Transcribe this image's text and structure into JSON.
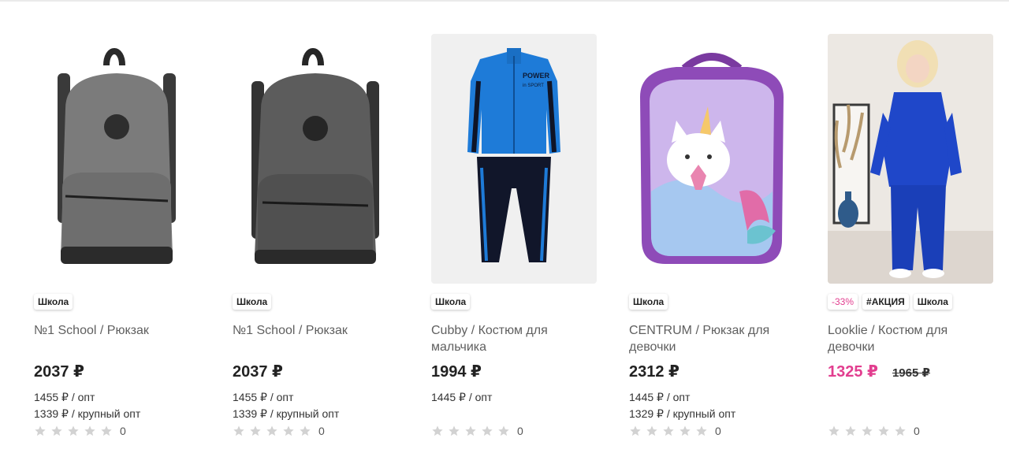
{
  "products": [
    {
      "image_icon": "backpack-grey-icon",
      "badges": [
        {
          "text": "Школа",
          "kind": "tag"
        }
      ],
      "title": "№1 School / Рюкзак",
      "price": "2037 ₽",
      "old_price": "",
      "opt": [
        "1455 ₽ / опт",
        "1339 ₽ / крупный опт"
      ],
      "rating_stars": 0,
      "rating_count": "0"
    },
    {
      "image_icon": "backpack-darkgrey-icon",
      "badges": [
        {
          "text": "Школа",
          "kind": "tag"
        }
      ],
      "title": "№1 School / Рюкзак",
      "price": "2037 ₽",
      "old_price": "",
      "opt": [
        "1455 ₽ / опт",
        "1339 ₽ / крупный опт"
      ],
      "rating_stars": 0,
      "rating_count": "0"
    },
    {
      "image_icon": "tracksuit-icon",
      "image_text": [
        "POWER",
        "in SPORT"
      ],
      "badges": [
        {
          "text": "Школа",
          "kind": "tag"
        }
      ],
      "title": "Cubby / Костюм для мальчика",
      "price": "1994 ₽",
      "old_price": "",
      "opt": [
        "1445 ₽ / опт"
      ],
      "rating_stars": 0,
      "rating_count": "0"
    },
    {
      "image_icon": "backpack-unicorn-cat-icon",
      "badges": [
        {
          "text": "Школа",
          "kind": "tag"
        }
      ],
      "title": "CENTRUM / Рюкзак для девочки",
      "price": "2312 ₽",
      "old_price": "",
      "opt": [
        "1445 ₽ / опт",
        "1329 ₽ / крупный опт"
      ],
      "rating_stars": 0,
      "rating_count": "0"
    },
    {
      "image_icon": "girl-blue-suit-photo-icon",
      "badges": [
        {
          "text": "-33%",
          "kind": "discount"
        },
        {
          "text": "#АКЦИЯ",
          "kind": "tag"
        },
        {
          "text": "Школа",
          "kind": "tag"
        }
      ],
      "title": "Looklie / Костюм для девочки",
      "price": "1325 ₽",
      "old_price": "1965 ₽",
      "opt": [],
      "rating_stars": 0,
      "rating_count": "0"
    }
  ],
  "colors": {
    "sale_price": "#e23e8f",
    "star_empty": "#d2d2d2",
    "title_text": "#5f5f5f"
  }
}
